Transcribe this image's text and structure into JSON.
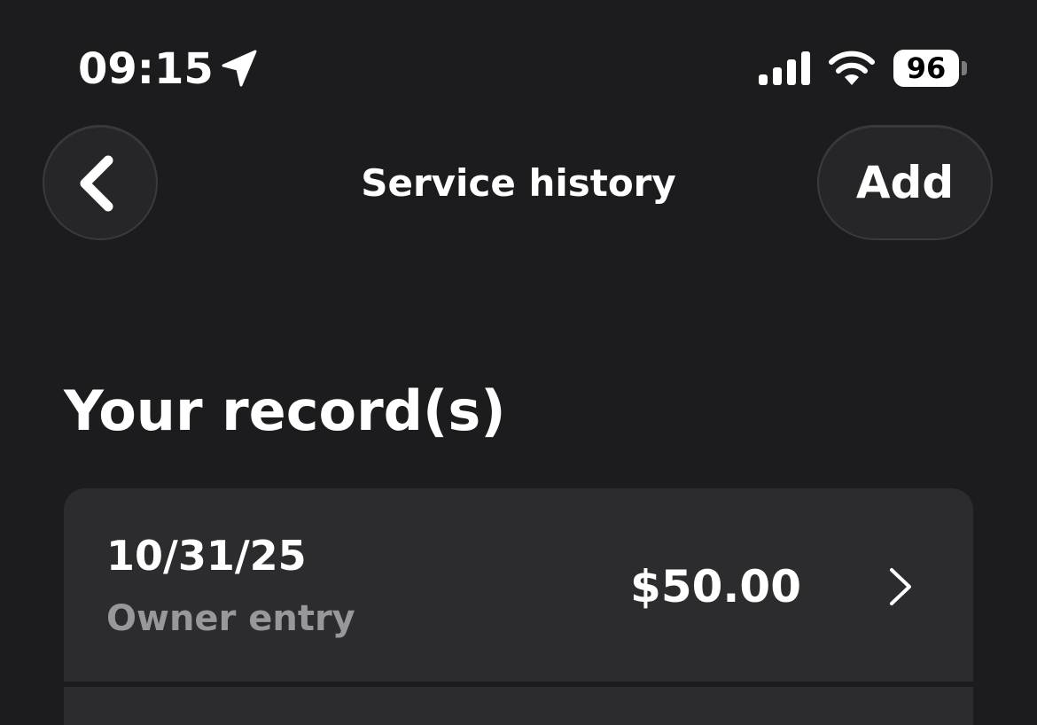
{
  "status_bar": {
    "time": "09:15",
    "battery": "96",
    "icons": [
      "location-arrow-icon",
      "cellular-signal-icon",
      "wifi-icon",
      "battery-icon"
    ]
  },
  "nav": {
    "back_icon": "chevron-left-icon",
    "title": "Service history",
    "add_label": "Add"
  },
  "section": {
    "title": "Your record(s)"
  },
  "records": [
    {
      "date": "10/31/25",
      "source": "Owner entry",
      "amount": "$50.00",
      "icon": "chevron-right-icon"
    }
  ],
  "colors": {
    "background": "#1c1c1e",
    "card": "#2c2c2e",
    "secondary_text": "#98989c",
    "primary_text": "#ffffff"
  }
}
